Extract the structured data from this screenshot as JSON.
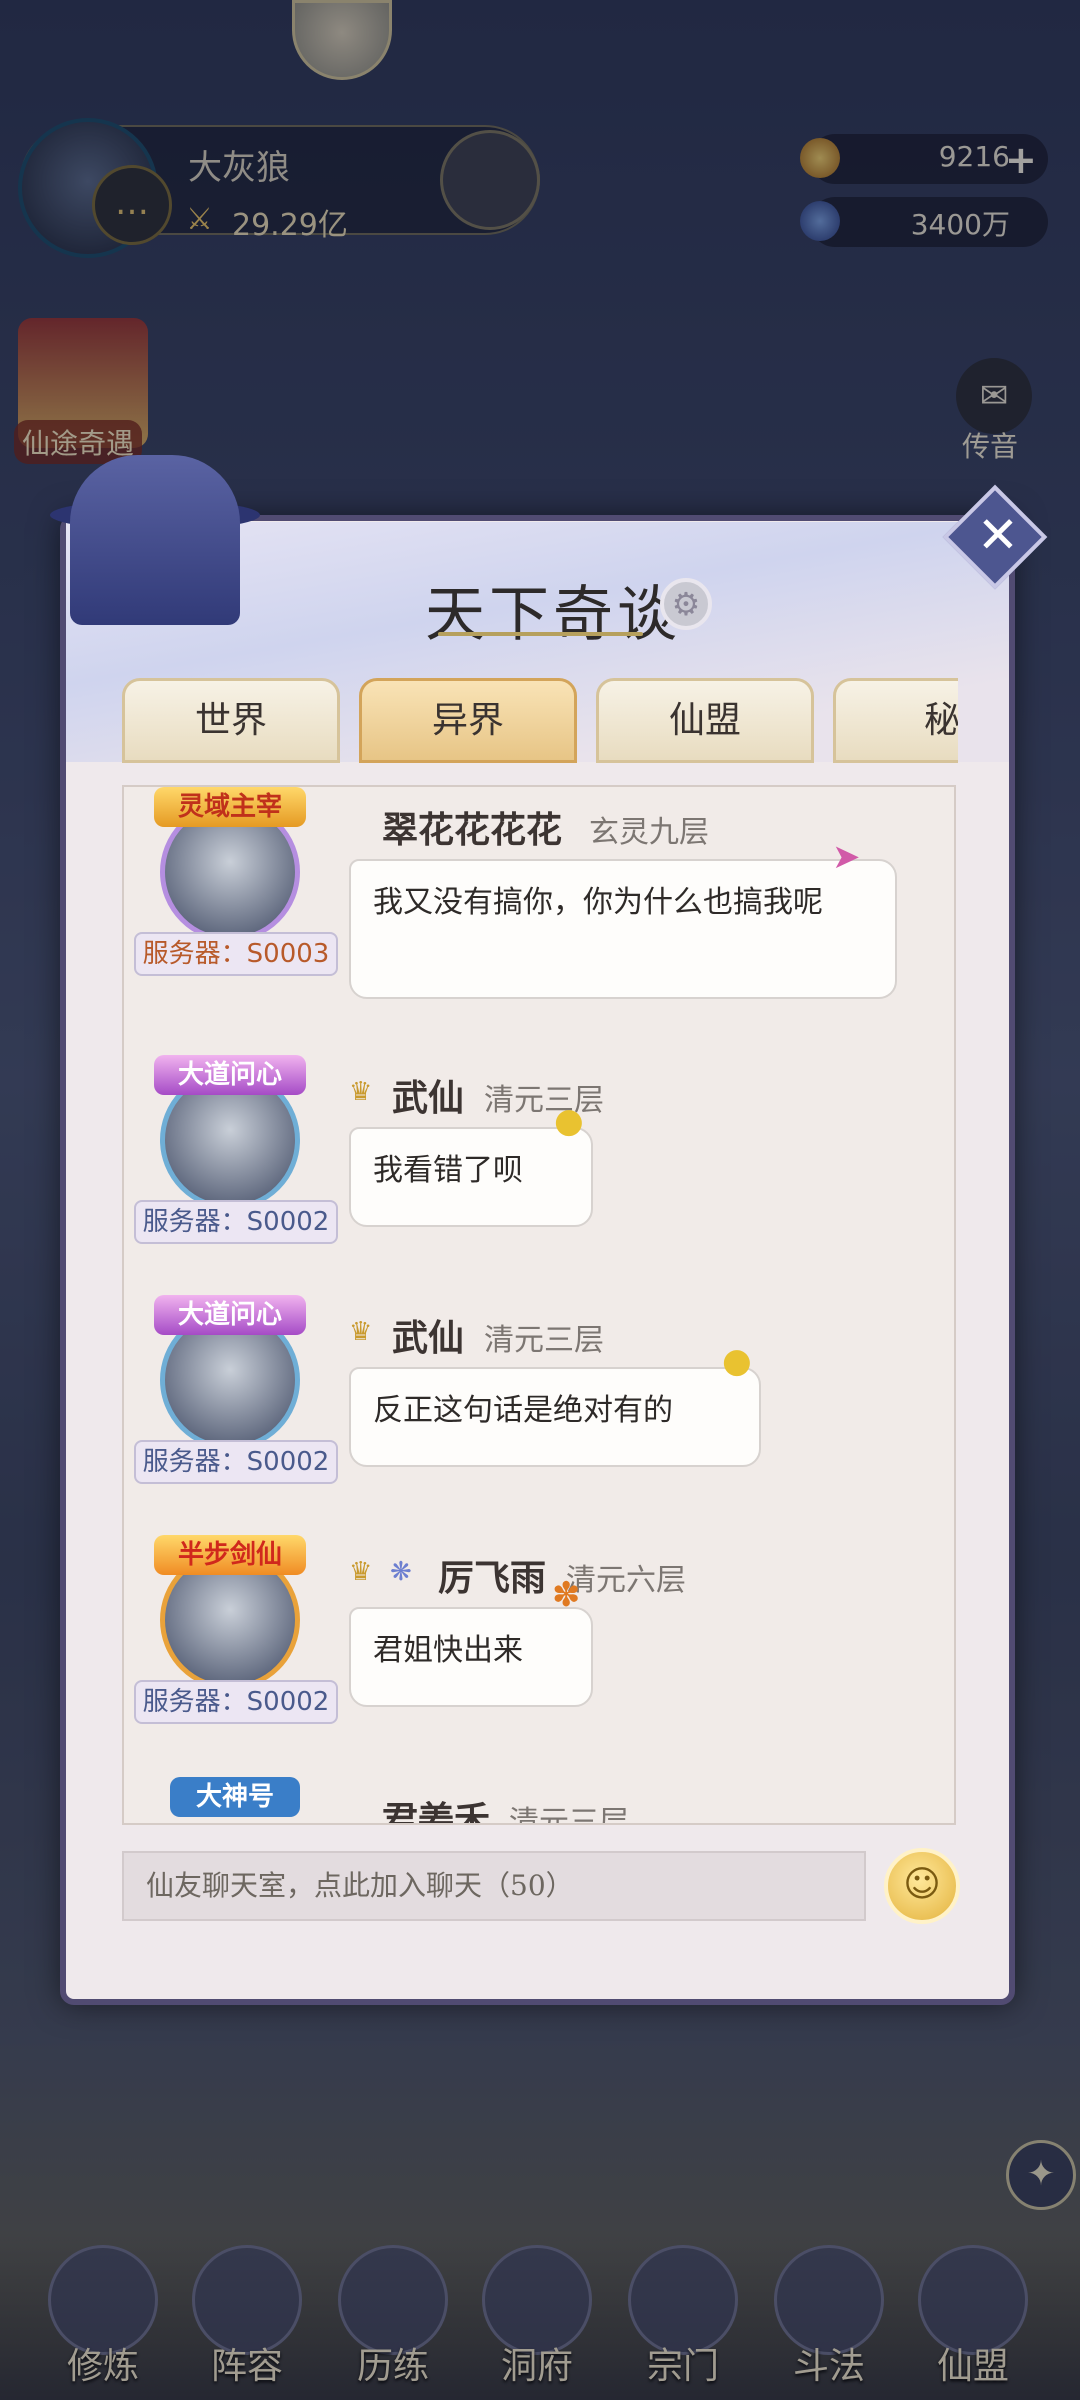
{
  "hud": {
    "player_name": "大灰狼",
    "power": "29.29亿",
    "currency1": "9216",
    "currency1_plus": "+",
    "currency2": "3400万",
    "event_label": "仙途奇遇",
    "mail_label": "传音"
  },
  "dialog": {
    "title": "天下奇谈",
    "tabs": [
      "世界",
      "异界",
      "仙盟",
      "秘"
    ],
    "active_tab": "异界"
  },
  "messages": [
    {
      "badge": "灵域主宰",
      "server": "服务器：S0003",
      "name": "翠花花花花",
      "realm": "玄灵九层",
      "text": "我又没有搞你，你为什么也搞我呢"
    },
    {
      "badge": "大道问心",
      "server": "服务器：S0002",
      "name": "武仙",
      "realm": "清元三层",
      "text": "我看错了呗"
    },
    {
      "badge": "大道问心",
      "server": "服务器：S0002",
      "name": "武仙",
      "realm": "清元三层",
      "text": "反正这句话是绝对有的"
    },
    {
      "badge": "半步剑仙",
      "server": "服务器：S0002",
      "name": "厉飞雨",
      "realm": "清元六层",
      "text": "君姐快出来"
    },
    {
      "badge": "大神号",
      "name": "君姜禾",
      "realm": "清元三层"
    }
  ],
  "input": {
    "placeholder": "仙友聊天室，点此加入聊天（50）"
  },
  "nav": [
    "修炼",
    "阵容",
    "历练",
    "洞府",
    "宗门",
    "斗法",
    "仙盟"
  ],
  "colors": {
    "dialog_border": "#514b72",
    "active_tab": "#e7c586",
    "bubble_bg": "#fefdfb"
  }
}
